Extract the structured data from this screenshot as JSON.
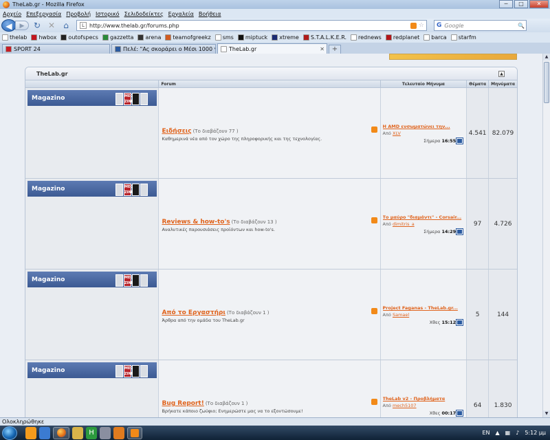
{
  "window": {
    "title": "TheLab.gr - Mozilla Firefox",
    "min": "─",
    "max": "□",
    "close": "✕"
  },
  "menu": [
    "Αρχείο",
    "Επεξεργασία",
    "Προβολή",
    "Ιστορικό",
    "Σελιδοδείκτες",
    "Εργαλεία",
    "Βοήθεια"
  ],
  "nav": {
    "url": "http://www.thelab.gr/forums.php",
    "search_placeholder": "Google",
    "back": "◀",
    "forward": "▶",
    "reload": "↻",
    "stop": "✕",
    "home": "⌂",
    "go": "🔍"
  },
  "bookmarks": [
    {
      "label": "thelab",
      "color": "#ffffff"
    },
    {
      "label": "hwbox",
      "color": "#c2151d"
    },
    {
      "label": "outofspecs",
      "color": "#222222"
    },
    {
      "label": "gazzetta",
      "color": "#2a8a3a"
    },
    {
      "label": "arena",
      "color": "#333333"
    },
    {
      "label": "teamofgreekz",
      "color": "#d15c23"
    },
    {
      "label": "sms",
      "color": "#ffffff"
    },
    {
      "label": "miptuck",
      "color": "#111111"
    },
    {
      "label": "xtreme",
      "color": "#1b2b73"
    },
    {
      "label": "S.T.A.L.K.E.R.",
      "color": "#b01b1b"
    },
    {
      "label": "rednews",
      "color": "#ffffff"
    },
    {
      "label": "redplanet",
      "color": "#b3161b"
    },
    {
      "label": "barca",
      "color": "#ffffff"
    },
    {
      "label": "starfm",
      "color": "#ffffff"
    }
  ],
  "tabs": [
    {
      "label": "SPORT 24",
      "color": "#c81d25",
      "width": 157
    },
    {
      "label": "Πελέ: \"Ας σκοράρει ο Μέσι 1000 γκ...",
      "color": "#2a5aa0",
      "width": 152
    },
    {
      "label": "TheLab.gr",
      "color": "#ffffff",
      "width": 160,
      "active": true
    }
  ],
  "forum": {
    "box_title": "TheLab.gr",
    "collapse": "▲",
    "col_forum": "Forum",
    "col_last": "Τελευταίο Μήνυμα",
    "col_threads": "Θέματα",
    "col_posts": "Μηνύματα",
    "banner_label": "Magazino",
    "rows": [
      {
        "title": "Ειδήσεις",
        "readers": "(Το διαβάζουν 77 )",
        "desc": "Καθημερινά νέα από τον χώρο της πληροφορικής και της τεχνολογίας.",
        "last_title": "Η AMD ενσωματώνει την...",
        "by_label": "Από",
        "last_by": "XLV",
        "day": "Σήμερα",
        "time": "16:55",
        "threads": "4.541",
        "posts": "82.079"
      },
      {
        "title": "Reviews & how-to's",
        "readers": "(Το διαβάζουν 13 )",
        "desc": "Αναλυτικές παρουσιάσεις προϊόντων και how-to's.",
        "last_title": "Το μαύρο \"διαμάντι\" - Corsair...",
        "by_label": "Από",
        "last_by": "dimitris_a",
        "day": "Σήμερα",
        "time": "14:29",
        "threads": "97",
        "posts": "4.726"
      },
      {
        "title": "Από το Εργαστήρι",
        "readers": "(Το διαβάζουν 1 )",
        "desc": "Άρθρα από την ομάδα του TheLab.gr",
        "last_title": "Project Faganas - TheLab.gr...",
        "by_label": "Από",
        "last_by": "Samael",
        "day": "Χθες",
        "time": "15:12",
        "threads": "5",
        "posts": "144"
      },
      {
        "title": "Bug Report!",
        "readers": "(Το διαβάζουν 1 )",
        "desc": "Βρήκατε κάποιο ζωύφιο; Ενημερώστε μας να το εξοντώσουμε!",
        "last_title": "TheLab v2 - Προβλήματα",
        "by_label": "Από",
        "last_by": "mech5107",
        "day": "Χθες",
        "time": "00:17",
        "threads": "64",
        "posts": "1.830"
      }
    ]
  },
  "status": "Ολοκληρώθηκε",
  "taskbar": {
    "lang": "EN",
    "clock": "5:12 μμ"
  }
}
